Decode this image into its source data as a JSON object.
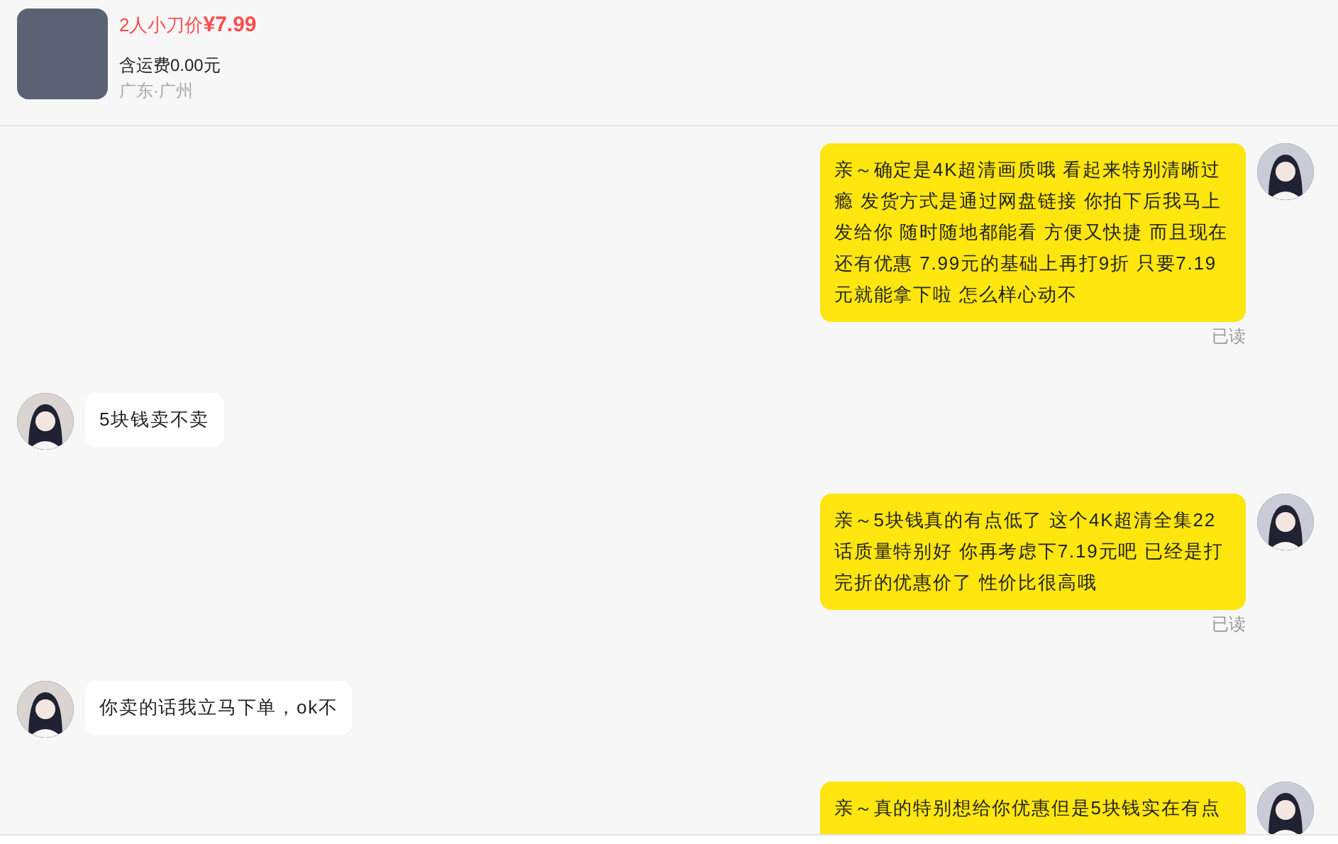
{
  "product": {
    "price_label": "2人小刀价",
    "price": "¥7.99",
    "shipping": "含运费0.00元",
    "location": "广东·广州"
  },
  "messages": [
    {
      "kind": "me",
      "text": "亲～确定是4K超清画质哦 看起来特别清晰过瘾 发货方式是通过网盘链接 你拍下后我马上发给你 随时随地都能看 方便又快捷 而且现在还有优惠 7.99元的基础上再打9折 只要7.19元就能拿下啦 怎么样心动不",
      "status": "已读"
    },
    {
      "kind": "other",
      "text": "5块钱卖不卖"
    },
    {
      "kind": "me",
      "text": "亲～5块钱真的有点低了 这个4K超清全集22话质量特别好 你再考虑下7.19元吧 已经是打完折的优惠价了 性价比很高哦",
      "status": "已读"
    },
    {
      "kind": "other",
      "text": "你卖的话我立马下单，ok不"
    },
    {
      "kind": "me",
      "text": "亲～真的特别想给你优惠但是5块钱实在有点"
    }
  ]
}
